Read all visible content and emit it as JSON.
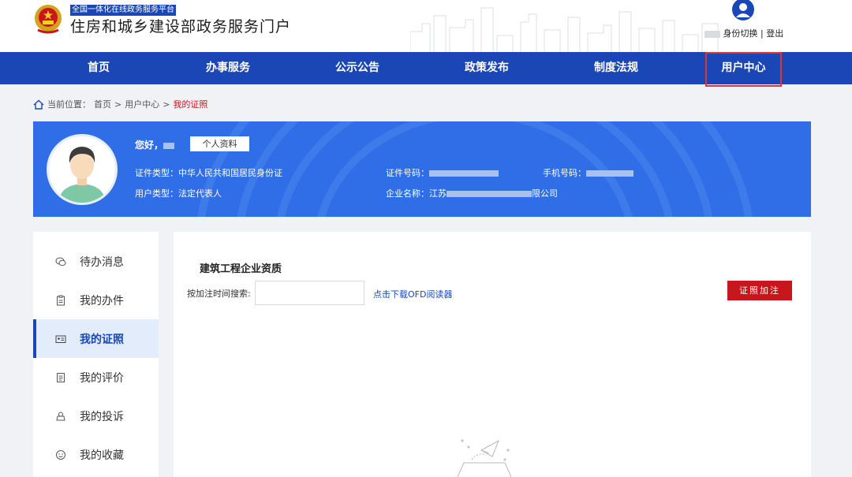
{
  "header": {
    "tagline": "全国一体化在线政务服务平台",
    "site_title": "住房和城乡建设部政务服务门户",
    "switch_identity": "身份切换",
    "separator": "|",
    "logout": "登出"
  },
  "nav": {
    "items": [
      {
        "label": "首页"
      },
      {
        "label": "办事服务"
      },
      {
        "label": "公示公告"
      },
      {
        "label": "政策发布"
      },
      {
        "label": "制度法规"
      },
      {
        "label": "用户中心"
      }
    ],
    "active_index": 5,
    "active_border_color": "#e0342e"
  },
  "breadcrumb": {
    "prefix": "当前位置：",
    "home": "首页",
    "sep": ">",
    "user_center": "用户中心",
    "current": "我的证照"
  },
  "profile": {
    "greeting": "您好，",
    "profile_button": "个人资料",
    "id_type_label": "证件类型：",
    "id_type_value": "中华人民共和国居民身份证",
    "id_number_label": "证件号码：",
    "phone_label": "手机号码：",
    "user_type_label": "用户类型：",
    "user_type_value": "法定代表人",
    "company_label": "企业名称：",
    "company_prefix": "江苏",
    "company_suffix": "限公司"
  },
  "sidebar": {
    "items": [
      {
        "label": "待办消息",
        "icon": "message-icon"
      },
      {
        "label": "我的办件",
        "icon": "clipboard-icon"
      },
      {
        "label": "我的证照",
        "icon": "id-card-icon"
      },
      {
        "label": "我的评价",
        "icon": "document-icon"
      },
      {
        "label": "我的投诉",
        "icon": "complaint-icon"
      },
      {
        "label": "我的收藏",
        "icon": "smiley-icon"
      }
    ],
    "active_index": 2
  },
  "content": {
    "section_title": "建筑工程企业资质",
    "search_label": "按加注时间搜索:",
    "search_value": "",
    "ofd_link": "点击下载OFD阅读器",
    "add_button": "证照加注"
  },
  "colors": {
    "brand_blue": "#1a47b5",
    "profile_blue": "#2f6ee6",
    "accent_red": "#c8161d"
  }
}
